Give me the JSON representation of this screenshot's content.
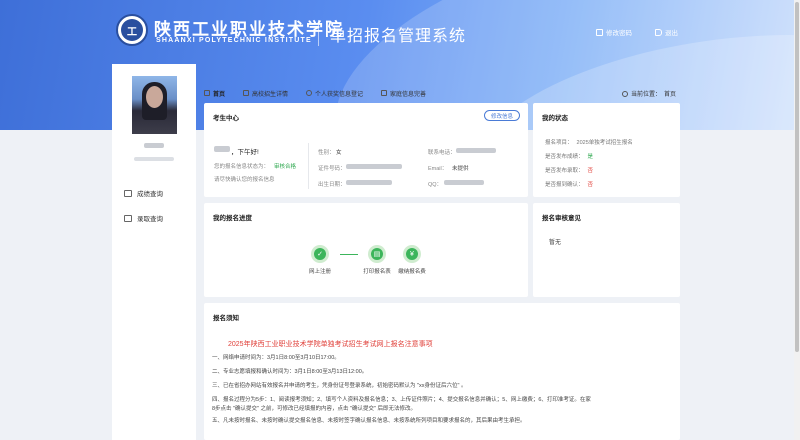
{
  "header": {
    "school_name_cn": "陕西工业职业技术学院",
    "school_name_en": "SHAANXI POLYTECHNIC INSTITUTE",
    "system_title": "单招报名管理系统",
    "change_password": "修改密码",
    "logout": "退出"
  },
  "sidebar": {
    "items": [
      {
        "label": "成绩查询",
        "icon": "chart-icon"
      },
      {
        "label": "录取查询",
        "icon": "user-search-icon"
      }
    ]
  },
  "tabs": [
    {
      "label": "首页",
      "icon": "home-icon",
      "active": true
    },
    {
      "label": "高校招生详情",
      "icon": "document-icon"
    },
    {
      "label": "个人获奖信息登记",
      "icon": "person-icon"
    },
    {
      "label": "家庭信息完善",
      "icon": "house-icon"
    }
  ],
  "breadcrumb": {
    "label": "当前位置：",
    "current": "首页"
  },
  "candidate_center": {
    "title": "考生中心",
    "edit_button": "修改信息",
    "greeting": "，下午好!",
    "tip_prefix": "您的报名信息状态为：",
    "tip_status": "审核合格",
    "tip_line2": "请尽快确认您的报名信息",
    "fields": {
      "gender_label": "性别：",
      "gender_value": "女",
      "id_label": "证件号码：",
      "birth_label": "出生日期：",
      "phone_label": "联系电话：",
      "email_label": "Email：",
      "email_value": "未提供",
      "qq_label": "QQ："
    }
  },
  "my_status": {
    "title": "我的状态",
    "rows": [
      {
        "label": "报名项目：",
        "value": "2025单独考试招生报名",
        "state": "normal"
      },
      {
        "label": "是否发布成绩：",
        "value": "是",
        "state": "ok"
      },
      {
        "label": "是否发布录取：",
        "value": "否",
        "state": "no"
      },
      {
        "label": "是否报到确认：",
        "value": "否",
        "state": "no"
      }
    ]
  },
  "progress": {
    "title": "我的报名进度",
    "steps": [
      {
        "label": "网上注册"
      },
      {
        "label": "打印报名表"
      },
      {
        "label": "缴纳报名费"
      }
    ]
  },
  "review": {
    "title": "报名审核意见",
    "content": "暂无"
  },
  "notice": {
    "title": "报名须知",
    "headline": "2025年陕西工业职业技术学院单独考试招生考试网上报名注意事项",
    "lines": [
      "一、网络申请时间为：3月1日8:00至3月10日17:00。",
      "二、专业志愿填报和确认时间为：3月1日8:00至3月13日12:00。",
      "三、已在省招办网站有效报名并申请的考生，凭身份证号登录系统，初始密码默认为 \"xx身份证后六位\" 。",
      "四、报名过程分为5步：1、阅读报考须知；2、填写个人资料及报名信息；3、上传证件照片；4、提交报名信息并确认；5、网上缴费；6、打印准考证。在家",
      "8步点击 \"确认提交\" 之前，可修改已经填报的内容，点击 \"确认提交\" 后即无法修改。",
      "五、凡未按时报名、未按时确认提交报名信息、未按时签字确认报名信息、未按系统所列项目和要求报名的，其后果由考生承担。"
    ]
  }
}
